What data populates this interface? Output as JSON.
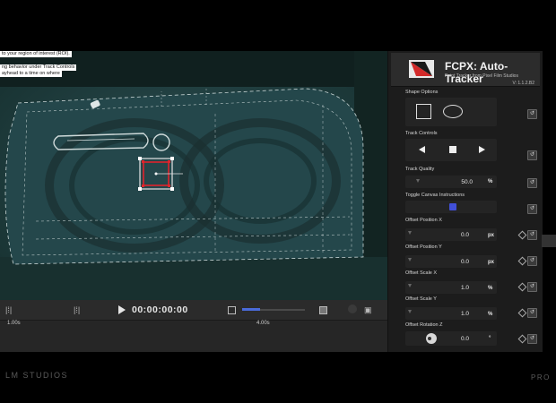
{
  "viewer": {
    "instructions": [
      "to your region of interest (ROI).",
      "ng behavior under Track Controls",
      "ayhead to a time on where"
    ]
  },
  "transport": {
    "timecode": "00:00:00:00",
    "ruler_labels": [
      "1.00s",
      "4.00s"
    ]
  },
  "inspector": {
    "title": "FCPX: Auto-Tracker",
    "subtitle": "Point Tracker from Pixel Film Studios",
    "version": "V: 1.1.2.B2",
    "shape_options_label": "Shape Options",
    "track_controls_label": "Track Controls",
    "track_quality": {
      "label": "Track Quality",
      "value": "50.0",
      "unit": "%"
    },
    "toggle_canvas_label": "Toggle Canvas Instructions",
    "offset_position_x": {
      "label": "Offset Position X",
      "value": "0.0",
      "unit": "px"
    },
    "offset_position_y": {
      "label": "Offset Position Y",
      "value": "0.0",
      "unit": "px"
    },
    "offset_scale_x": {
      "label": "Offset Scale X",
      "value": "1.0",
      "unit": "%"
    },
    "offset_scale_y": {
      "label": "Offset Scale Y",
      "value": "1.0",
      "unit": "%"
    },
    "offset_rotation_z": {
      "label": "Offset Rotation Z",
      "value": "0.0",
      "unit": "°"
    }
  },
  "branding": {
    "left": "LM STUDIOS",
    "right": "PRO"
  },
  "colors": {
    "accent": "#4150d8",
    "roi": "#e0242c"
  }
}
